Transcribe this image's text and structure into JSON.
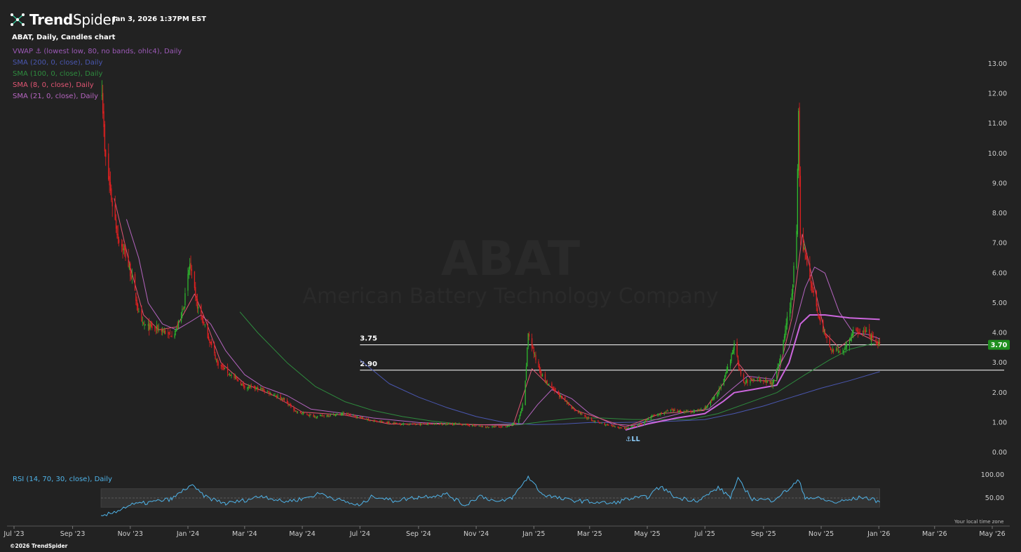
{
  "header": {
    "brand": "TrendSpider",
    "brand_bold": "Trend",
    "brand_thin": "Spider",
    "timestamp": "Jan 3, 2026 1:37PM EST",
    "chart_title": "ABAT, Daily, Candles chart",
    "logo_icon": "trendspider-network-icon"
  },
  "indicators": [
    {
      "label": "VWAP ⚓ (lowest low, 80, no bands, ohlc4), Daily",
      "color": "#9b59b6"
    },
    {
      "label": "SMA (200, 0, close), Daily",
      "color": "#4a57b0"
    },
    {
      "label": "SMA (100, 0, close), Daily",
      "color": "#2e8b3e"
    },
    {
      "label": "SMA (8, 0, close), Daily",
      "color": "#e05573"
    },
    {
      "label": "SMA (21, 0, close), Daily",
      "color": "#b565c0"
    }
  ],
  "rsi_label": "RSI (14, 70, 30, close), Daily",
  "footer": {
    "local_time": "Your local time zone",
    "copyright": "©2026 TrendSpider"
  },
  "colors": {
    "background": "#222222",
    "up": "#2eb82e",
    "down": "#e02020",
    "level_line": "#ffffff",
    "price_badge": "#1f8f1f",
    "rsi": "#4fb3e8",
    "sma200": "#4a57b0",
    "sma100": "#2e8b3e",
    "sma8": "#e05573",
    "sma21": "#b565c0",
    "vwap": "#cc66dd"
  },
  "chart_data": {
    "type": "candlestick",
    "watermark": {
      "symbol": "ABAT",
      "name": "American Battery Technology Company"
    },
    "x_tick_labels": [
      "Jul '23",
      "Sep '23",
      "Nov '23",
      "Jan '24",
      "Mar '24",
      "May '24",
      "Jul '24",
      "Sep '24",
      "Nov '24",
      "Jan '25",
      "Mar '25",
      "May '25",
      "Jul '25",
      "Sep '25",
      "Nov '25",
      "Jan '26",
      "Mar '26",
      "May '26"
    ],
    "x_ticks": [
      "2023-07-01",
      "2023-09-01",
      "2023-11-01",
      "2024-01-01",
      "2024-03-01",
      "2024-05-01",
      "2024-07-01",
      "2024-09-01",
      "2024-11-01",
      "2025-01-01",
      "2025-03-01",
      "2025-05-01",
      "2025-07-01",
      "2025-09-01",
      "2025-11-01",
      "2026-01-01",
      "2026-03-01",
      "2026-05-01"
    ],
    "xlim": [
      "2023-07-01",
      "2026-05-20"
    ],
    "y_ticks": [
      "0.00",
      "1.00",
      "2.00",
      "3.00",
      "4.00",
      "5.00",
      "6.00",
      "7.00",
      "8.00",
      "9.00",
      "10.00",
      "11.00",
      "12.00",
      "13.00"
    ],
    "ylim": [
      -0.3,
      13.5
    ],
    "horizontal_levels": [
      {
        "label": "3.75",
        "value": 3.6,
        "start": "2024-07-01"
      },
      {
        "label": "2.90",
        "value": 2.75,
        "start": "2024-07-01"
      }
    ],
    "last_price": {
      "label": "3.70",
      "value": 3.6
    },
    "anchor_marker": {
      "label": "⚓LL",
      "date": "2025-04-08",
      "value": 0.7
    },
    "price_path": [
      [
        "2023-10-01",
        13.0
      ],
      [
        "2023-10-05",
        10.0
      ],
      [
        "2023-10-12",
        8.5
      ],
      [
        "2023-10-19",
        7.2
      ],
      [
        "2023-10-26",
        6.7
      ],
      [
        "2023-11-03",
        5.8
      ],
      [
        "2023-11-12",
        4.3
      ],
      [
        "2023-11-20",
        4.2
      ],
      [
        "2023-12-05",
        4.1
      ],
      [
        "2023-12-12",
        3.9
      ],
      [
        "2023-12-20",
        4.1
      ],
      [
        "2023-12-28",
        5.0
      ],
      [
        "2024-01-03",
        6.3
      ],
      [
        "2024-01-10",
        5.0
      ],
      [
        "2024-01-20",
        4.1
      ],
      [
        "2024-02-01",
        3.0
      ],
      [
        "2024-02-15",
        2.6
      ],
      [
        "2024-03-01",
        2.2
      ],
      [
        "2024-03-20",
        2.1
      ],
      [
        "2024-04-10",
        1.8
      ],
      [
        "2024-04-25",
        1.35
      ],
      [
        "2024-05-15",
        1.2
      ],
      [
        "2024-06-15",
        1.3
      ],
      [
        "2024-07-15",
        1.05
      ],
      [
        "2024-08-15",
        0.95
      ],
      [
        "2024-09-15",
        0.95
      ],
      [
        "2024-10-15",
        0.95
      ],
      [
        "2024-11-10",
        0.85
      ],
      [
        "2024-12-01",
        0.85
      ],
      [
        "2024-12-15",
        1.0
      ],
      [
        "2024-12-22",
        1.8
      ],
      [
        "2024-12-26",
        4.0
      ],
      [
        "2025-01-03",
        3.1
      ],
      [
        "2025-01-12",
        2.4
      ],
      [
        "2025-01-25",
        2.0
      ],
      [
        "2025-02-10",
        1.5
      ],
      [
        "2025-03-01",
        1.1
      ],
      [
        "2025-03-20",
        0.9
      ],
      [
        "2025-04-08",
        0.8
      ],
      [
        "2025-04-25",
        0.95
      ],
      [
        "2025-05-05",
        1.2
      ],
      [
        "2025-05-25",
        1.4
      ],
      [
        "2025-06-15",
        1.35
      ],
      [
        "2025-06-30",
        1.45
      ],
      [
        "2025-07-10",
        1.8
      ],
      [
        "2025-07-20",
        2.3
      ],
      [
        "2025-08-01",
        3.6
      ],
      [
        "2025-08-10",
        2.3
      ],
      [
        "2025-08-25",
        2.5
      ],
      [
        "2025-09-10",
        2.3
      ],
      [
        "2025-09-20",
        3.3
      ],
      [
        "2025-09-26",
        4.5
      ],
      [
        "2025-10-01",
        5.2
      ],
      [
        "2025-10-06",
        7.5
      ],
      [
        "2025-10-08",
        11.3
      ],
      [
        "2025-10-10",
        7.0
      ],
      [
        "2025-10-14",
        6.8
      ],
      [
        "2025-10-22",
        5.6
      ],
      [
        "2025-11-01",
        4.2
      ],
      [
        "2025-11-12",
        3.4
      ],
      [
        "2025-11-24",
        3.4
      ],
      [
        "2025-12-05",
        4.0
      ],
      [
        "2025-12-15",
        4.1
      ],
      [
        "2025-12-25",
        3.8
      ],
      [
        "2026-01-02",
        3.6
      ]
    ],
    "series": [
      {
        "name": "SMA (200, 0, close), Daily",
        "key": "sma200",
        "points": [
          [
            "2024-07-01",
            3.1
          ],
          [
            "2024-08-01",
            2.3
          ],
          [
            "2024-09-01",
            1.85
          ],
          [
            "2024-10-01",
            1.5
          ],
          [
            "2024-11-01",
            1.2
          ],
          [
            "2024-12-01",
            1.0
          ],
          [
            "2025-01-01",
            0.93
          ],
          [
            "2025-02-01",
            0.95
          ],
          [
            "2025-03-01",
            1.0
          ],
          [
            "2025-04-01",
            1.0
          ],
          [
            "2025-05-01",
            1.02
          ],
          [
            "2025-06-01",
            1.05
          ],
          [
            "2025-07-01",
            1.1
          ],
          [
            "2025-08-01",
            1.3
          ],
          [
            "2025-09-01",
            1.55
          ],
          [
            "2025-10-01",
            1.85
          ],
          [
            "2025-11-01",
            2.15
          ],
          [
            "2025-12-01",
            2.4
          ],
          [
            "2026-01-02",
            2.7
          ]
        ]
      },
      {
        "name": "SMA (100, 0, close), Daily",
        "key": "sma100",
        "points": [
          [
            "2024-02-25",
            4.7
          ],
          [
            "2024-03-15",
            4.0
          ],
          [
            "2024-04-15",
            3.0
          ],
          [
            "2024-05-15",
            2.2
          ],
          [
            "2024-06-15",
            1.7
          ],
          [
            "2024-07-15",
            1.4
          ],
          [
            "2024-08-15",
            1.2
          ],
          [
            "2024-09-15",
            1.05
          ],
          [
            "2024-10-15",
            0.95
          ],
          [
            "2024-11-15",
            0.92
          ],
          [
            "2024-12-15",
            0.92
          ],
          [
            "2025-01-15",
            1.05
          ],
          [
            "2025-02-15",
            1.15
          ],
          [
            "2025-03-15",
            1.15
          ],
          [
            "2025-04-15",
            1.1
          ],
          [
            "2025-05-15",
            1.1
          ],
          [
            "2025-06-15",
            1.1
          ],
          [
            "2025-07-15",
            1.3
          ],
          [
            "2025-08-15",
            1.65
          ],
          [
            "2025-09-15",
            2.0
          ],
          [
            "2025-10-15",
            2.6
          ],
          [
            "2025-11-10",
            3.1
          ],
          [
            "2025-12-01",
            3.45
          ],
          [
            "2026-01-02",
            3.7
          ]
        ]
      },
      {
        "name": "SMA (21, 0, close), Daily",
        "key": "sma21",
        "points": [
          [
            "2023-10-28",
            7.8
          ],
          [
            "2023-11-10",
            6.5
          ],
          [
            "2023-11-20",
            5.0
          ],
          [
            "2023-12-05",
            4.3
          ],
          [
            "2023-12-20",
            4.1
          ],
          [
            "2024-01-05",
            4.4
          ],
          [
            "2024-01-15",
            4.6
          ],
          [
            "2024-01-25",
            4.3
          ],
          [
            "2024-02-10",
            3.4
          ],
          [
            "2024-03-01",
            2.6
          ],
          [
            "2024-03-20",
            2.2
          ],
          [
            "2024-04-15",
            1.9
          ],
          [
            "2024-05-10",
            1.45
          ],
          [
            "2024-06-15",
            1.3
          ],
          [
            "2024-07-15",
            1.15
          ],
          [
            "2024-09-01",
            1.0
          ],
          [
            "2024-11-01",
            0.92
          ],
          [
            "2024-12-20",
            0.95
          ],
          [
            "2025-01-05",
            1.6
          ],
          [
            "2025-01-20",
            2.1
          ],
          [
            "2025-02-10",
            1.8
          ],
          [
            "2025-03-01",
            1.3
          ],
          [
            "2025-03-25",
            0.95
          ],
          [
            "2025-04-15",
            0.9
          ],
          [
            "2025-05-10",
            1.1
          ],
          [
            "2025-06-10",
            1.35
          ],
          [
            "2025-07-05",
            1.45
          ],
          [
            "2025-07-25",
            2.0
          ],
          [
            "2025-08-15",
            2.55
          ],
          [
            "2025-09-10",
            2.45
          ],
          [
            "2025-09-28",
            3.5
          ],
          [
            "2025-10-15",
            5.5
          ],
          [
            "2025-10-25",
            6.2
          ],
          [
            "2025-11-05",
            6.0
          ],
          [
            "2025-11-20",
            4.7
          ],
          [
            "2025-12-05",
            4.0
          ],
          [
            "2025-12-20",
            3.95
          ],
          [
            "2026-01-02",
            3.8
          ]
        ]
      },
      {
        "name": "SMA (8, 0, close), Daily",
        "key": "sma8",
        "points": [
          [
            "2023-10-15",
            8.5
          ],
          [
            "2023-11-01",
            6.2
          ],
          [
            "2023-11-15",
            4.6
          ],
          [
            "2023-12-01",
            4.1
          ],
          [
            "2023-12-20",
            4.2
          ],
          [
            "2024-01-08",
            5.3
          ],
          [
            "2024-01-20",
            4.4
          ],
          [
            "2024-02-05",
            3.0
          ],
          [
            "2024-03-01",
            2.3
          ],
          [
            "2024-04-01",
            1.9
          ],
          [
            "2024-05-01",
            1.35
          ],
          [
            "2024-06-15",
            1.25
          ],
          [
            "2024-08-01",
            0.95
          ],
          [
            "2024-10-01",
            0.95
          ],
          [
            "2024-12-10",
            0.9
          ],
          [
            "2024-12-30",
            2.8
          ],
          [
            "2025-01-15",
            2.3
          ],
          [
            "2025-02-15",
            1.4
          ],
          [
            "2025-04-08",
            0.85
          ],
          [
            "2025-05-15",
            1.3
          ],
          [
            "2025-06-30",
            1.4
          ],
          [
            "2025-08-05",
            3.0
          ],
          [
            "2025-08-20",
            2.4
          ],
          [
            "2025-09-15",
            2.4
          ],
          [
            "2025-10-01",
            4.5
          ],
          [
            "2025-10-12",
            7.3
          ],
          [
            "2025-10-20",
            6.2
          ],
          [
            "2025-11-05",
            4.0
          ],
          [
            "2025-11-20",
            3.5
          ],
          [
            "2025-12-10",
            4.0
          ],
          [
            "2026-01-02",
            3.65
          ]
        ]
      },
      {
        "name": "VWAP ⚓ (lowest low, 80, no bands, ohlc4), Daily",
        "key": "vwap",
        "points": [
          [
            "2025-04-08",
            0.75
          ],
          [
            "2025-05-01",
            0.95
          ],
          [
            "2025-06-01",
            1.15
          ],
          [
            "2025-07-01",
            1.3
          ],
          [
            "2025-07-20",
            1.7
          ],
          [
            "2025-08-01",
            2.0
          ],
          [
            "2025-08-20",
            2.1
          ],
          [
            "2025-09-15",
            2.25
          ],
          [
            "2025-09-28",
            3.0
          ],
          [
            "2025-10-10",
            4.3
          ],
          [
            "2025-10-20",
            4.6
          ],
          [
            "2025-11-05",
            4.6
          ],
          [
            "2025-12-01",
            4.5
          ],
          [
            "2026-01-02",
            4.45
          ]
        ]
      }
    ],
    "rsi": {
      "name": "RSI (14, 70, 30, close), Daily",
      "ticks": [
        "100.00",
        "50.00"
      ],
      "bands": [
        70,
        50,
        30
      ],
      "ylim": [
        0,
        100
      ],
      "points": [
        [
          "2023-10-01",
          8
        ],
        [
          "2023-10-15",
          20
        ],
        [
          "2023-11-01",
          35
        ],
        [
          "2023-11-20",
          40
        ],
        [
          "2023-12-15",
          48
        ],
        [
          "2024-01-04",
          78
        ],
        [
          "2024-01-20",
          52
        ],
        [
          "2024-02-10",
          38
        ],
        [
          "2024-03-01",
          45
        ],
        [
          "2024-03-20",
          55
        ],
        [
          "2024-04-10",
          42
        ],
        [
          "2024-05-01",
          48
        ],
        [
          "2024-05-20",
          60
        ],
        [
          "2024-06-10",
          45
        ],
        [
          "2024-07-01",
          33
        ],
        [
          "2024-07-15",
          55
        ],
        [
          "2024-08-05",
          44
        ],
        [
          "2024-09-01",
          52
        ],
        [
          "2024-10-01",
          58
        ],
        [
          "2024-10-20",
          34
        ],
        [
          "2024-11-05",
          55
        ],
        [
          "2024-11-25",
          40
        ],
        [
          "2024-12-10",
          52
        ],
        [
          "2024-12-26",
          96
        ],
        [
          "2025-01-10",
          58
        ],
        [
          "2025-02-01",
          47
        ],
        [
          "2025-03-01",
          42
        ],
        [
          "2025-03-25",
          38
        ],
        [
          "2025-04-10",
          48
        ],
        [
          "2025-05-01",
          52
        ],
        [
          "2025-05-15",
          75
        ],
        [
          "2025-06-01",
          50
        ],
        [
          "2025-06-25",
          45
        ],
        [
          "2025-07-15",
          72
        ],
        [
          "2025-07-28",
          52
        ],
        [
          "2025-08-05",
          90
        ],
        [
          "2025-08-20",
          48
        ],
        [
          "2025-09-10",
          45
        ],
        [
          "2025-09-25",
          65
        ],
        [
          "2025-10-08",
          88
        ],
        [
          "2025-10-15",
          52
        ],
        [
          "2025-11-01",
          48
        ],
        [
          "2025-11-15",
          40
        ],
        [
          "2025-12-01",
          46
        ],
        [
          "2025-12-15",
          52
        ],
        [
          "2025-12-25",
          47
        ],
        [
          "2026-01-02",
          41
        ]
      ]
    }
  }
}
